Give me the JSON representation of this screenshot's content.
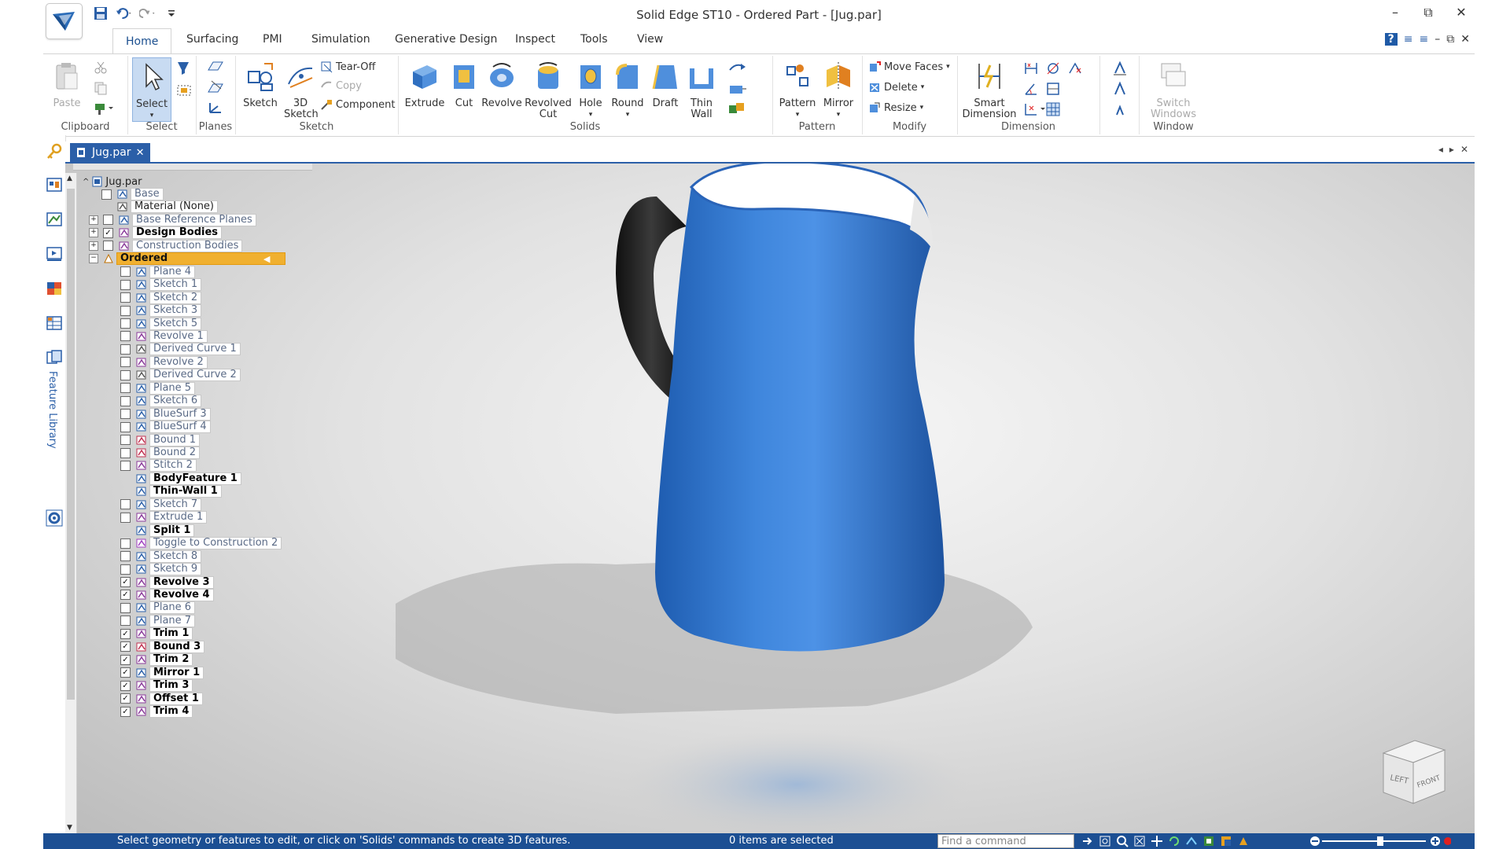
{
  "window": {
    "title": "Solid Edge ST10 - Ordered Part - [Jug.par]",
    "controls": [
      "–",
      "⧉",
      "✕"
    ],
    "inner_controls": [
      "?",
      "≡",
      "≡",
      "–",
      "⧉",
      "✕"
    ]
  },
  "quick_access": [
    "save-icon",
    "undo-icon",
    "redo-icon",
    "customize-icon"
  ],
  "tabs": [
    {
      "label": "Home",
      "active": true
    },
    {
      "label": "Surfacing"
    },
    {
      "label": "PMI"
    },
    {
      "label": "Simulation"
    },
    {
      "label": "Generative Design"
    },
    {
      "label": "Inspect"
    },
    {
      "label": "Tools"
    },
    {
      "label": "View"
    }
  ],
  "ribbon": {
    "clipboard": {
      "label": "Clipboard",
      "paste": "Paste"
    },
    "select": {
      "label": "Select",
      "select": "Select"
    },
    "planes": {
      "label": "Planes"
    },
    "sketch": {
      "label": "Sketch",
      "sketch": "Sketch",
      "sketch3d_line1": "3D",
      "sketch3d_line2": "Sketch",
      "tearoff": "Tear-Off",
      "copy": "Copy",
      "component": "Component"
    },
    "solids": {
      "label": "Solids",
      "extrude": "Extrude",
      "cut": "Cut",
      "revolve": "Revolve",
      "revolved_cut_line1": "Revolved",
      "revolved_cut_line2": "Cut",
      "hole": "Hole",
      "round": "Round",
      "draft": "Draft",
      "thinwall_line1": "Thin",
      "thinwall_line2": "Wall"
    },
    "pattern": {
      "label": "Pattern",
      "pattern": "Pattern",
      "mirror": "Mirror"
    },
    "modify": {
      "label": "Modify",
      "move_faces": "Move Faces",
      "delete": "Delete",
      "resize": "Resize"
    },
    "dimension": {
      "label": "Dimension",
      "smart_line1": "Smart",
      "smart_line2": "Dimension"
    },
    "window": {
      "label": "Window",
      "switch_line1": "Switch",
      "switch_line2": "Windows"
    }
  },
  "rail": {
    "feature_library": "Feature Library"
  },
  "doc_tab": {
    "label": "Jug.par"
  },
  "tree": {
    "root": "Jug.par",
    "items": [
      {
        "label": "Base",
        "style": "faded",
        "checked": false
      },
      {
        "label": "Material (None)",
        "style": "normal"
      },
      {
        "label": "Base Reference Planes",
        "style": "faded",
        "checked": false,
        "expander": "+"
      },
      {
        "label": "Design Bodies",
        "style": "bold",
        "checked": true,
        "expander": "+"
      },
      {
        "label": "Construction Bodies",
        "style": "faded",
        "checked": false,
        "expander": "+"
      },
      {
        "label": "Ordered",
        "style": "ordered",
        "expander": "−"
      },
      {
        "label": "Plane 4",
        "style": "faded",
        "checked": false
      },
      {
        "label": "Sketch 1",
        "style": "faded",
        "checked": false
      },
      {
        "label": "Sketch 2",
        "style": "faded",
        "checked": false
      },
      {
        "label": "Sketch 3",
        "style": "faded",
        "checked": false
      },
      {
        "label": "Sketch 5",
        "style": "faded",
        "checked": false
      },
      {
        "label": "Revolve 1",
        "style": "faded",
        "checked": false
      },
      {
        "label": "Derived Curve 1",
        "style": "faded",
        "checked": false
      },
      {
        "label": "Revolve 2",
        "style": "faded",
        "checked": false
      },
      {
        "label": "Derived Curve 2",
        "style": "faded",
        "checked": false
      },
      {
        "label": "Plane 5",
        "style": "faded",
        "checked": false
      },
      {
        "label": "Sketch 6",
        "style": "faded",
        "checked": false
      },
      {
        "label": "BlueSurf 3",
        "style": "faded",
        "checked": false
      },
      {
        "label": "BlueSurf 4",
        "style": "faded",
        "checked": false
      },
      {
        "label": "Bound 1",
        "style": "faded",
        "checked": false
      },
      {
        "label": "Bound 2",
        "style": "faded",
        "checked": false
      },
      {
        "label": "Stitch 2",
        "style": "faded",
        "checked": false
      },
      {
        "label": "BodyFeature 1",
        "style": "bold"
      },
      {
        "label": "Thin-Wall 1",
        "style": "bold"
      },
      {
        "label": "Sketch 7",
        "style": "faded",
        "checked": false
      },
      {
        "label": "Extrude 1",
        "style": "faded",
        "checked": false
      },
      {
        "label": "Split 1",
        "style": "bold"
      },
      {
        "label": "Toggle to Construction 2",
        "style": "faded",
        "checked": false
      },
      {
        "label": "Sketch 8",
        "style": "faded",
        "checked": false
      },
      {
        "label": "Sketch 9",
        "style": "faded",
        "checked": false
      },
      {
        "label": "Revolve 3",
        "style": "bold",
        "checked": true
      },
      {
        "label": "Revolve 4",
        "style": "bold",
        "checked": true
      },
      {
        "label": "Plane 6",
        "style": "faded",
        "checked": false
      },
      {
        "label": "Plane 7",
        "style": "faded",
        "checked": false
      },
      {
        "label": "Trim 1",
        "style": "bold",
        "checked": true
      },
      {
        "label": "Bound 3",
        "style": "bold",
        "checked": true
      },
      {
        "label": "Trim 2",
        "style": "bold",
        "checked": true
      },
      {
        "label": "Mirror 1",
        "style": "bold",
        "checked": true
      },
      {
        "label": "Trim 3",
        "style": "bold",
        "checked": true
      },
      {
        "label": "Offset 1",
        "style": "bold",
        "checked": true
      },
      {
        "label": "Trim 4",
        "style": "bold",
        "checked": true
      }
    ]
  },
  "navcube": {
    "left": "LEFT",
    "front": "FRONT"
  },
  "status": {
    "message": "Select geometry or features to edit, or click on 'Solids' commands to create 3D features.",
    "selection": "0 items are selected",
    "find_placeholder": "Find a command"
  },
  "colors": {
    "accent": "#2b5fa8",
    "status_bar": "#1c4f93",
    "jug_blue": "#3b7fd4",
    "ordered_highlight": "#f0b030"
  }
}
